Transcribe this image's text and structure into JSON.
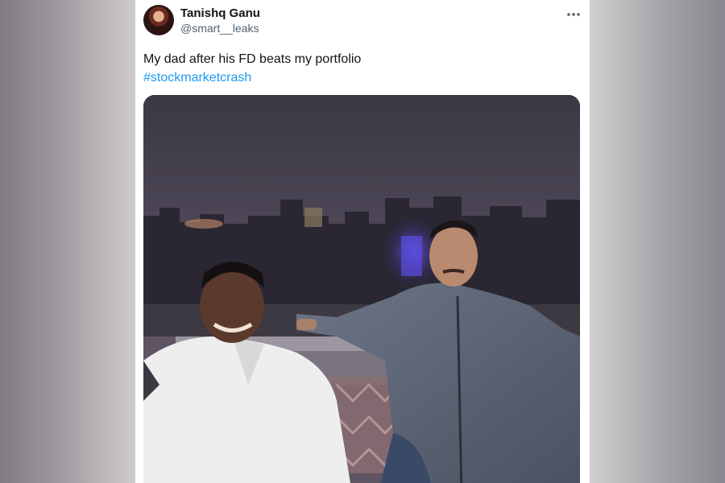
{
  "tweet": {
    "author": {
      "display_name": "Tanishq Ganu",
      "handle": "@smart__leaks"
    },
    "text_line1": "My dad after his FD beats my portfolio",
    "hashtag": "#stockmarketcrash",
    "more_icon": "more-horizontal-icon",
    "colors": {
      "text": "#0f1419",
      "secondary": "#536471",
      "link": "#1d9bf0"
    }
  }
}
